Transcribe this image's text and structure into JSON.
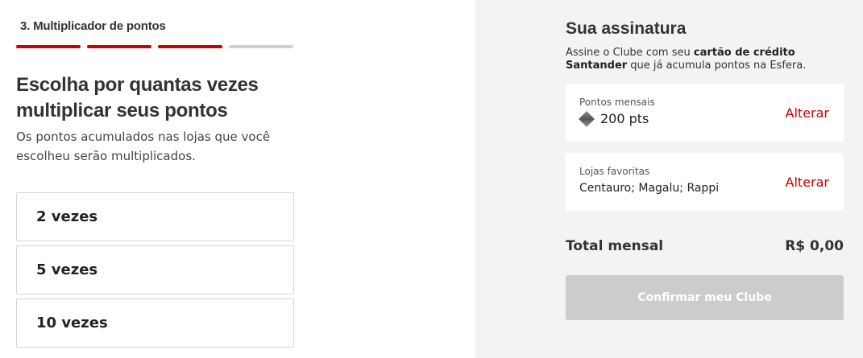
{
  "step": {
    "title": "3. Multiplicador de pontos",
    "progress_segments": [
      true,
      true,
      true,
      false
    ]
  },
  "main": {
    "heading": "Escolha por quantas vezes multiplicar seus pontos",
    "subtext": "Os pontos acumulados nas lojas que você escolheu serão multiplicados.",
    "options": [
      {
        "label": "2 vezes"
      },
      {
        "label": "5 vezes"
      },
      {
        "label": "10 vezes"
      }
    ]
  },
  "subscription": {
    "title": "Sua assinatura",
    "desc_prefix": "Assine o Clube com seu ",
    "desc_bold": "cartão de crédito Santander",
    "desc_suffix": " que já acumula pontos na Esfera.",
    "monthly_points": {
      "label": "Pontos mensais",
      "value": "200 pts",
      "icon": "diamond-icon",
      "action": "Alterar"
    },
    "favorite_stores": {
      "label": "Lojas favoritas",
      "value": "Centauro; Magalu; Rappi",
      "action": "Alterar"
    },
    "total": {
      "label": "Total mensal",
      "value": "R$ 0,00"
    },
    "confirm_button": "Confirmar meu Clube"
  },
  "colors": {
    "accent": "#cc0000",
    "progress_inactive": "#d0d0d0",
    "panel_background": "#f1f3f5",
    "button_disabled": "#cccccc"
  }
}
